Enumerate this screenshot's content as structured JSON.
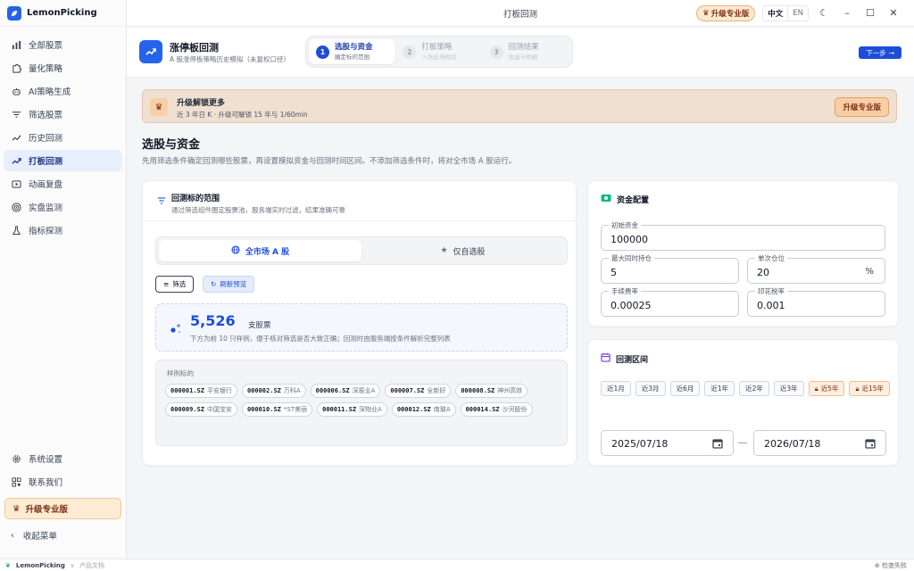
{
  "app": {
    "name": "LemonPicking",
    "window_title": "打板回测"
  },
  "titlebar": {
    "pro_label": "升级专业版",
    "lang_zh": "中文",
    "lang_en": "EN"
  },
  "sidebar": {
    "items": [
      {
        "label": "全部股票",
        "icon": "bar-chart-icon"
      },
      {
        "label": "量化策略",
        "icon": "puzzle-icon"
      },
      {
        "label": "AI策略生成",
        "icon": "robot-icon"
      },
      {
        "label": "筛选股票",
        "icon": "filter-icon"
      },
      {
        "label": "历史回测",
        "icon": "trend-icon"
      },
      {
        "label": "打板回测",
        "icon": "trend-up-icon",
        "active": true
      },
      {
        "label": "动画复盘",
        "icon": "play-icon"
      },
      {
        "label": "实盘监测",
        "icon": "radar-icon"
      },
      {
        "label": "指标探测",
        "icon": "flask-icon"
      }
    ],
    "settings": "系统设置",
    "contact": "联系我们",
    "upgrade": "升级专业版",
    "collapse": "收起菜单"
  },
  "header": {
    "title": "涨停板回测",
    "subtitle": "A 股涨停板策略历史模拟（未复权口径）",
    "steps": [
      {
        "num": "1",
        "title": "选股与资金",
        "sub": "圈定标的范围"
      },
      {
        "num": "2",
        "title": "打板策略",
        "sub": "入场出场规则"
      },
      {
        "num": "3",
        "title": "回测结果",
        "sub": "收益与明细"
      }
    ],
    "next": "下一步"
  },
  "banner": {
    "title": "升级解锁更多",
    "subtitle": "近 3 年日 K · 升级可解锁 15 年与 1/60min",
    "button": "升级专业版"
  },
  "section": {
    "title": "选股与资金",
    "desc": "先用筛选条件确定回测哪些股票，再设置模拟资金与回测时间区间。不添加筛选条件时，将对全市场 A 股运行。"
  },
  "scope": {
    "title": "回测标的范围",
    "subtitle": "通过筛选组件圈定股票池，服务端实时过滤，结果准确可靠",
    "seg_all": "全市场 A 股",
    "seg_watch": "仅自选股",
    "filter_btn": "筛选",
    "refresh_btn": "刷新预览",
    "count": "5,526",
    "count_unit": "支股票",
    "count_desc": "下方为前 10 只样例，便于核对筛选是否大致正确；回测时由服务端按条件解析完整列表",
    "sample_label": "样例标的",
    "samples": [
      {
        "code": "000001.SZ",
        "name": "平安银行"
      },
      {
        "code": "000002.SZ",
        "name": "万科A"
      },
      {
        "code": "000006.SZ",
        "name": "深振业A"
      },
      {
        "code": "000007.SZ",
        "name": "全新好"
      },
      {
        "code": "000008.SZ",
        "name": "神州高铁"
      },
      {
        "code": "000009.SZ",
        "name": "中国宝安"
      },
      {
        "code": "000010.SZ",
        "name": "*ST美丽"
      },
      {
        "code": "000011.SZ",
        "name": "深物业A"
      },
      {
        "code": "000012.SZ",
        "name": "南玻A"
      },
      {
        "code": "000014.SZ",
        "name": "沙河股份"
      }
    ]
  },
  "capital": {
    "title": "资金配置",
    "initial_label": "初始资金",
    "initial_value": "100000",
    "maxpos_label": "最大同时持仓",
    "maxpos_value": "5",
    "single_label": "单次仓位",
    "single_value": "20",
    "single_suffix": "%",
    "fee_label": "手续费率",
    "fee_value": "0.00025",
    "stamp_label": "印花税率",
    "stamp_value": "0.001"
  },
  "range": {
    "title": "回测区间",
    "chips": [
      {
        "label": "近1月",
        "locked": false
      },
      {
        "label": "近3月",
        "locked": false
      },
      {
        "label": "近6月",
        "locked": false
      },
      {
        "label": "近1年",
        "locked": false
      },
      {
        "label": "近2年",
        "locked": false
      },
      {
        "label": "近3年",
        "locked": false
      },
      {
        "label": "近5年",
        "locked": true
      },
      {
        "label": "近15年",
        "locked": true
      }
    ],
    "start": "2025/07/18",
    "end": "2026/07/18"
  },
  "statusbar": {
    "app": "LemonPicking",
    "version": "v",
    "docs": "产品文档",
    "status": "检查失败"
  },
  "colors": {
    "accent": "#1d4ed8",
    "pro": "#f8cfa5"
  }
}
